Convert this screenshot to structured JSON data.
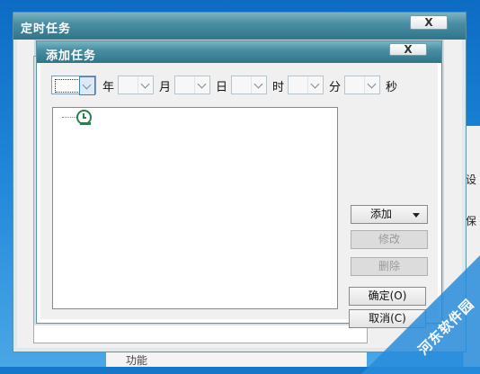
{
  "outer_window": {
    "title": "定时任务",
    "close": "X"
  },
  "inner_window": {
    "title": "添加任务",
    "close": "X"
  },
  "date_units": {
    "year": "年",
    "month": "月",
    "day": "日",
    "hour": "时",
    "minute": "分",
    "second": "秒"
  },
  "buttons": {
    "add": "添加",
    "edit": "修改",
    "delete": "删除",
    "ok": "确定(O)",
    "cancel": "取消(C)"
  },
  "tree": {
    "root_icon": "clock-icon"
  },
  "background_app": {
    "side_tab_1": "设",
    "side_tab_2": "保",
    "bottom_text": "功能"
  },
  "watermark": {
    "text": "河东软件园"
  },
  "colors": {
    "titlebar": "#4a8ea3",
    "desktop": "#1677c9",
    "button_disabled_text": "#9a9a9a"
  }
}
